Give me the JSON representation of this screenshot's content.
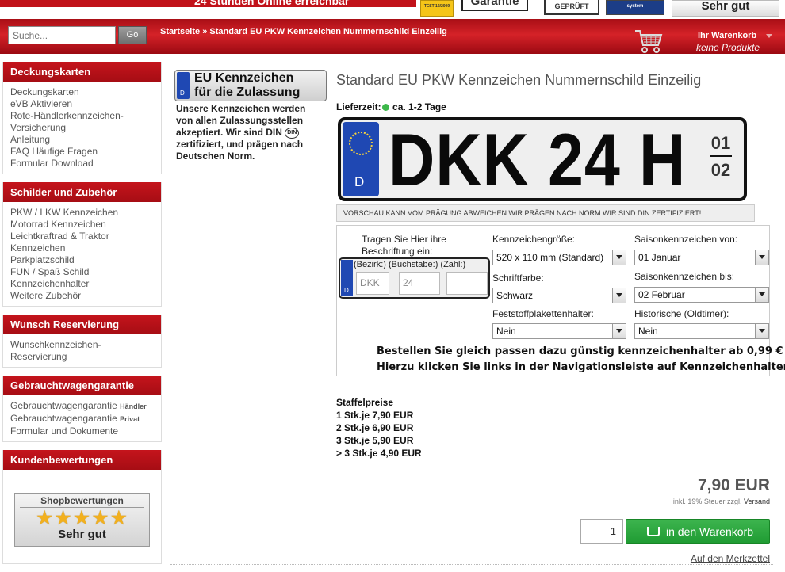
{
  "top_strip": {
    "banner_text": "24 Stunden Online erreichbar",
    "badges": {
      "test_badge": "TEST 12/2009",
      "garantie": "Garantie",
      "geprueft": "GEPRÜFT",
      "system": "system",
      "sehr_gut": "Sehr gut"
    }
  },
  "header": {
    "search_placeholder": "Suche...",
    "go_label": "Go",
    "breadcrumb": "Startseite » Standard EU PKW Kennzeichen Nummernschild Einzeilig",
    "cart_title": "Ihr Warenkorb",
    "cart_subtitle": "keine Produkte"
  },
  "sidebar": {
    "boxes": [
      {
        "title": "Deckungskarten",
        "items": [
          "Deckungskarten",
          "eVB Aktivieren",
          "Rote-Händlerkennzeichen-",
          "Versicherung",
          "Anleitung",
          "FAQ Häufige Fragen",
          "Formular Download"
        ]
      },
      {
        "title": "Schilder und Zubehör",
        "items": [
          "PKW / LKW Kennzeichen",
          "Motorrad Kennzeichen",
          "Leichtkraftrad & Traktor",
          "Kennzeichen",
          "Parkplatzschild",
          "FUN / Spaß Schild",
          "Kennzeichenhalter",
          "Weitere Zubehör"
        ]
      },
      {
        "title": "Wunsch Reservierung",
        "items": [
          "Wunschkennzeichen-",
          "Reservierung"
        ]
      },
      {
        "title": "Gebrauchtwagengarantie",
        "items": [
          "Gebrauchtwagengarantie",
          "Gebrauchtwagengarantie",
          "Formular und Dokumente"
        ],
        "item_tags": [
          "Händler",
          "Privat",
          ""
        ]
      },
      {
        "title": "Kundenbewertungen",
        "items": []
      }
    ],
    "reviews_widget": {
      "title": "Shopbewertungen",
      "stars": "★★★★★",
      "rating": "Sehr gut"
    }
  },
  "eu_badge": {
    "title_line1": "EU Kennzeichen",
    "title_line2": "für die Zulassung",
    "country": "D",
    "text_before_din": "Unsere Kennzeichen werden von allen Zulassungsstellen akzeptiert. Wir sind DIN",
    "din_mark": "DIN",
    "text_after_din": "zertifiziert, und prägen nach Deutschen Norm."
  },
  "product": {
    "title": "Standard EU PKW Kennzeichen Nummernschild Einzeilig",
    "lieferzeit_label": "Lieferzeit:",
    "lieferzeit_value": "ca. 1-2 Tage",
    "plate_text": "DKK 24 H",
    "plate_country": "D",
    "plate_season_from": "01",
    "plate_season_to": "02",
    "preview_note": "VORSCHAU KANN VOM PRÄGUNG ABWEICHEN WIR PRÄGEN NACH NORM WIR SIND DIN ZERTIFIZIERT!"
  },
  "options": {
    "hint": "Tragen Sie Hier ihre Beschriftung ein:",
    "mini_plate_labels": "(Bezirk:) (Buchstabe:) (Zahl:)",
    "mini_plate_country": "D",
    "bezirk_value": "DKK",
    "zahl_value": "24",
    "buchstabe_value": "",
    "groesse_label": "Kennzeichengröße:",
    "groesse_value": "520 x 110 mm (Standard)",
    "schriftfarbe_label": "Schriftfarbe:",
    "schriftfarbe_value": "Schwarz",
    "plakette_label": "Feststoffplakettenhalter:",
    "plakette_value": "Nein",
    "saison_von_label": "Saisonkennzeichen von:",
    "saison_von_value": "01 Januar",
    "saison_bis_label": "Saisonkennzeichen bis:",
    "saison_bis_value": "02 Februar",
    "historisch_label": "Historische (Oldtimer):",
    "historisch_value": "Nein",
    "promo_line1": "Bestellen Sie gleich passen dazu günstig kennzeichenhalter ab 0,99 €",
    "promo_line2": "Hierzu klicken Sie links in der Navigationsleiste auf Kennzeichenhalter !"
  },
  "staffel": {
    "title": "Staffelpreise",
    "rows": [
      "1 Stk.je 7,90 EUR",
      "2 Stk.je 6,90 EUR",
      "3 Stk.je 5,90 EUR",
      "> 3 Stk.je 4,90 EUR"
    ]
  },
  "buy": {
    "price": "7,90 EUR",
    "tax_text": "inkl. 19% Steuer zzgl.",
    "versand_link": "Versand",
    "quantity": "1",
    "add_to_cart": "in den Warenkorb",
    "merkzettel": "Auf den Merkzettel"
  },
  "colors": {
    "brand_red": "#c5141c",
    "eu_blue": "#1f48b3",
    "cart_green": "#2aa73e",
    "status_green": "#3db84a"
  }
}
